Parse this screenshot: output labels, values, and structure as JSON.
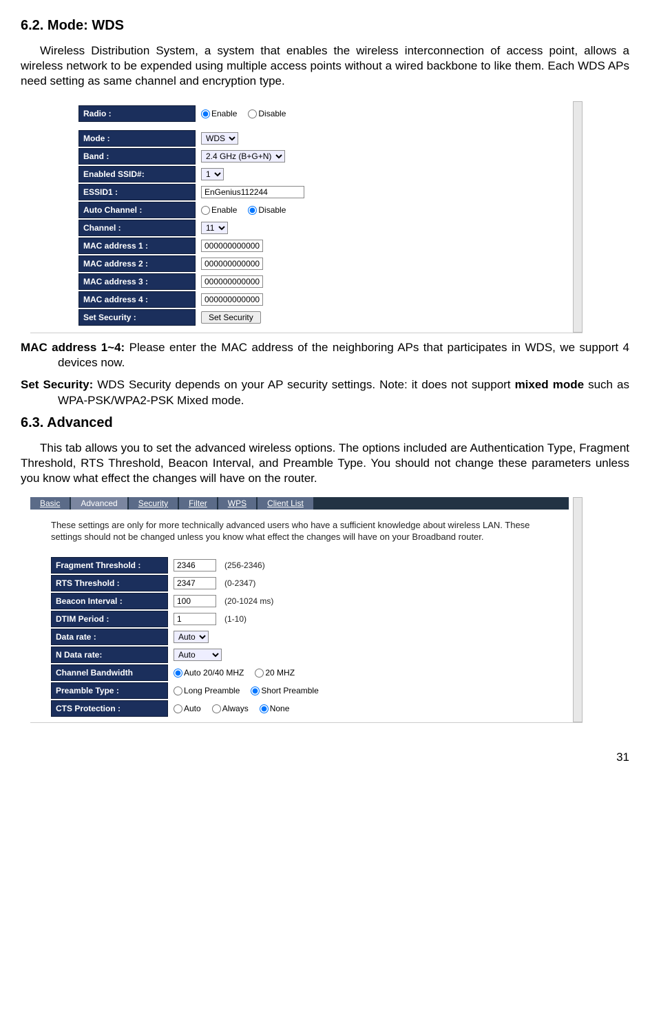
{
  "sec62": {
    "heading": "6.2. Mode: WDS",
    "intro": "Wireless Distribution System, a system that enables the wireless interconnection of access point, allows a wireless network to be expended using multiple access points without a wired backbone to like them. Each WDS APs need setting as same channel and encryption type.",
    "rows": {
      "radio_label": "Radio :",
      "radio_enable": "Enable",
      "radio_disable": "Disable",
      "mode_label": "Mode :",
      "mode_value": "WDS",
      "band_label": "Band :",
      "band_value": "2.4 GHz (B+G+N)",
      "enabled_ssid_label": "Enabled SSID#:",
      "enabled_ssid_value": "1",
      "essid_label": "ESSID1 :",
      "essid_value": "EnGenius112244",
      "autoch_label": "Auto Channel :",
      "autoch_enable": "Enable",
      "autoch_disable": "Disable",
      "channel_label": "Channel :",
      "channel_value": "11",
      "mac1_label": "MAC address 1 :",
      "mac2_label": "MAC address 2 :",
      "mac3_label": "MAC address 3 :",
      "mac4_label": "MAC address 4 :",
      "mac_value": "000000000000",
      "setsec_label": "Set Security :",
      "setsec_btn": "Set Security"
    },
    "bullet1_bold": "MAC address 1~4:",
    "bullet1_rest": " Please enter the MAC address of the neighboring APs that participates in WDS, we support 4 devices now.",
    "bullet2_bold": "Set Security:",
    "bullet2_rest_a": " WDS Security depends on your AP security settings. Note: it does not support ",
    "bullet2_rest_b": "mixed mode",
    "bullet2_rest_c": " such as WPA-PSK/WPA2-PSK Mixed mode."
  },
  "sec63": {
    "heading": "6.3. Advanced",
    "intro": "This tab allows you to set the advanced wireless options. The options included are Authentication Type, Fragment Threshold, RTS Threshold, Beacon Interval, and Preamble Type. You should not change these parameters unless you know what effect the changes will have on the router.",
    "tabs": {
      "basic": "Basic",
      "advanced": "Advanced",
      "security": "Security",
      "filter": "Filter",
      "wps": "WPS",
      "client": "Client List"
    },
    "note": "These settings are only for more technically advanced users who have a sufficient knowledge about wireless LAN. These settings should not be changed unless you know what effect the changes will have on your Broadband router.",
    "rows": {
      "frag_label": "Fragment Threshold :",
      "frag_val": "2346",
      "frag_range": "(256-2346)",
      "rts_label": "RTS Threshold :",
      "rts_val": "2347",
      "rts_range": "(0-2347)",
      "beacon_label": "Beacon Interval :",
      "beacon_val": "100",
      "beacon_range": "(20-1024 ms)",
      "dtim_label": "DTIM Period :",
      "dtim_val": "1",
      "dtim_range": "(1-10)",
      "datarate_label": "Data rate :",
      "datarate_val": "Auto",
      "ndatarate_label": "N Data rate:",
      "ndatarate_val": "Auto",
      "chbw_label": "Channel Bandwidth",
      "chbw_a": "Auto 20/40 MHZ",
      "chbw_b": "20 MHZ",
      "preamble_label": "Preamble Type :",
      "preamble_a": "Long Preamble",
      "preamble_b": "Short Preamble",
      "cts_label": "CTS Protection :",
      "cts_a": "Auto",
      "cts_b": "Always",
      "cts_c": "None"
    }
  },
  "pageno": "31"
}
